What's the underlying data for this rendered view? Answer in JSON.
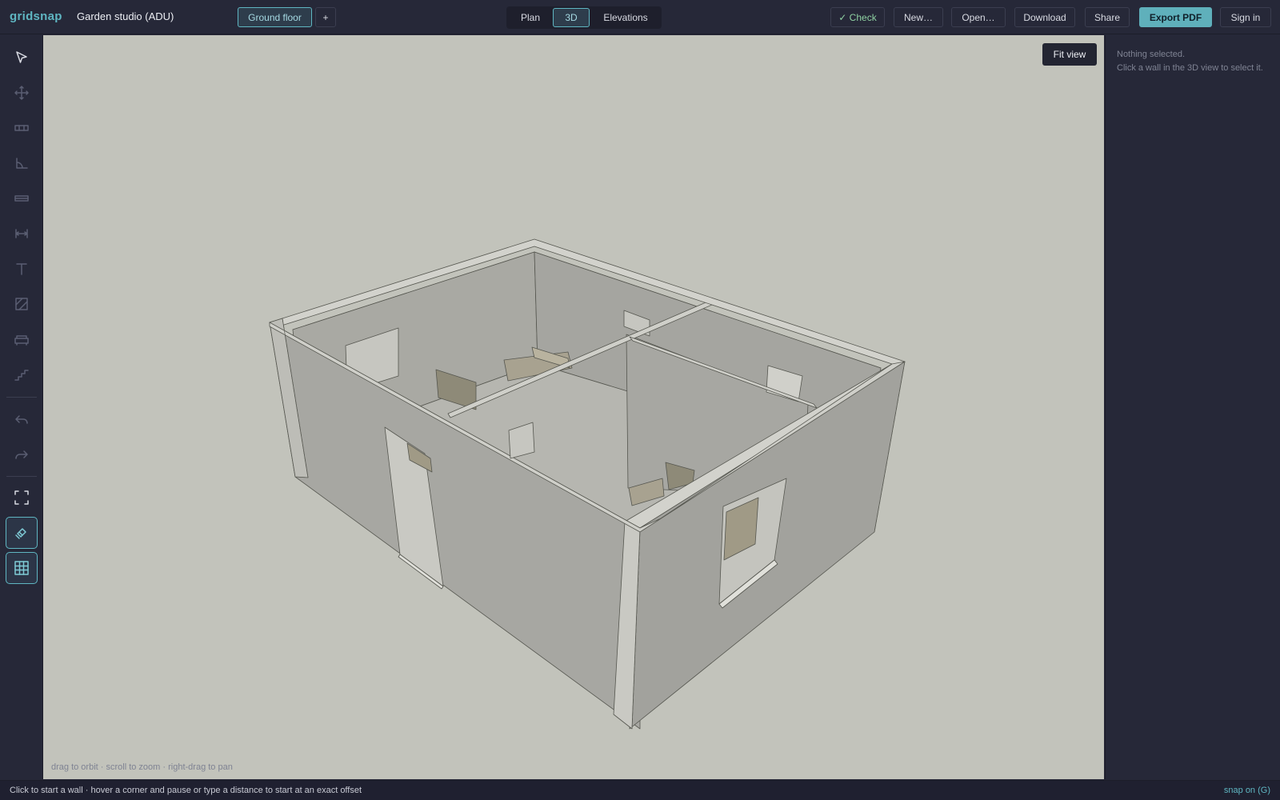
{
  "app": {
    "logo": "gridsnap",
    "project_title": "Garden studio (ADU)"
  },
  "header": {
    "floor_button": "Ground floor",
    "add_floor": "+",
    "view_tabs": [
      {
        "label": "Plan",
        "active": false
      },
      {
        "label": "3D",
        "active": true
      },
      {
        "label": "Elevations",
        "active": false
      }
    ],
    "actions": {
      "check": "✓ Check",
      "new": "New…",
      "open": "Open…",
      "download": "Download",
      "share": "Share",
      "export": "Export PDF",
      "signin": "Sign in"
    }
  },
  "toolbar": {
    "tools": [
      {
        "name": "select-tool",
        "icon": "pointer-icon",
        "state": "enabled"
      },
      {
        "name": "move-tool",
        "icon": "move-icon",
        "state": "disabled"
      },
      {
        "name": "wall-tool",
        "icon": "wall-icon",
        "state": "disabled"
      },
      {
        "name": "angle-tool",
        "icon": "angle-icon",
        "state": "disabled"
      },
      {
        "name": "window-tool",
        "icon": "window-icon",
        "state": "disabled"
      },
      {
        "name": "dimension-tool",
        "icon": "dimension-icon",
        "state": "disabled"
      },
      {
        "name": "text-tool",
        "icon": "text-icon",
        "state": "disabled"
      },
      {
        "name": "hatch-tool",
        "icon": "hatch-icon",
        "state": "disabled"
      },
      {
        "name": "furniture-tool",
        "icon": "sofa-icon",
        "state": "disabled"
      },
      {
        "name": "stairs-tool",
        "icon": "stairs-icon",
        "state": "disabled"
      },
      {
        "name": "undo-button",
        "icon": "undo-icon",
        "state": "disabled"
      },
      {
        "name": "redo-button",
        "icon": "redo-icon",
        "state": "disabled"
      },
      {
        "name": "fit-button",
        "icon": "fit-frame-icon",
        "state": "enabled"
      },
      {
        "name": "snap-toggle",
        "icon": "magnet-icon",
        "state": "on"
      },
      {
        "name": "grid-toggle",
        "icon": "grid-icon",
        "state": "on"
      }
    ]
  },
  "viewport": {
    "fit_view": "Fit view",
    "hint": "drag to orbit · scroll to zoom · right-drag to pan"
  },
  "inspector": {
    "line1": "Nothing selected.",
    "line2": "Click a wall in the 3D view to select it."
  },
  "status": {
    "message": "Click to start a wall · hover a corner and pause or type a distance to start at an exact offset",
    "snap": "snap on (G)"
  },
  "colors": {
    "accent": "#5fb6c2",
    "background": "#262838",
    "viewport": "#c2c3bb",
    "check_green": "#8fd1a2"
  }
}
